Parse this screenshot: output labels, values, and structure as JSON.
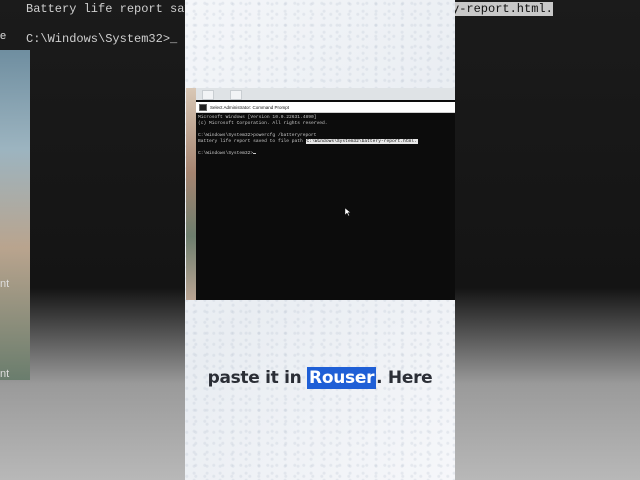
{
  "background": {
    "top_line_1": "Battery life report saved",
    "top_line_1_path": "y-report.html.",
    "top_line_2": "C:\\Windows\\System32>_",
    "left_fragments": [
      "e",
      "nt",
      "nt"
    ]
  },
  "window": {
    "title": "Select Administrator: Command Prompt"
  },
  "console": {
    "lines": [
      "Microsoft Windows [Version 10.0.22631.4890]",
      "(c) Microsoft Corporation. All rights reserved.",
      "",
      "C:\\Windows\\System32>powercfg /batteryreport",
      "Battery life report saved to file path "
    ],
    "saved_path": "C:\\Windows\\System32\\battery-report.html.",
    "prompt": "C:\\Windows\\System32>"
  },
  "caption": {
    "before": "paste it in ",
    "highlight": "Rouser",
    "after": ". Here"
  },
  "colors": {
    "console_bg": "#0c0c0c",
    "console_text": "#c8c8c8",
    "caption_highlight": "#1f5fd6"
  }
}
